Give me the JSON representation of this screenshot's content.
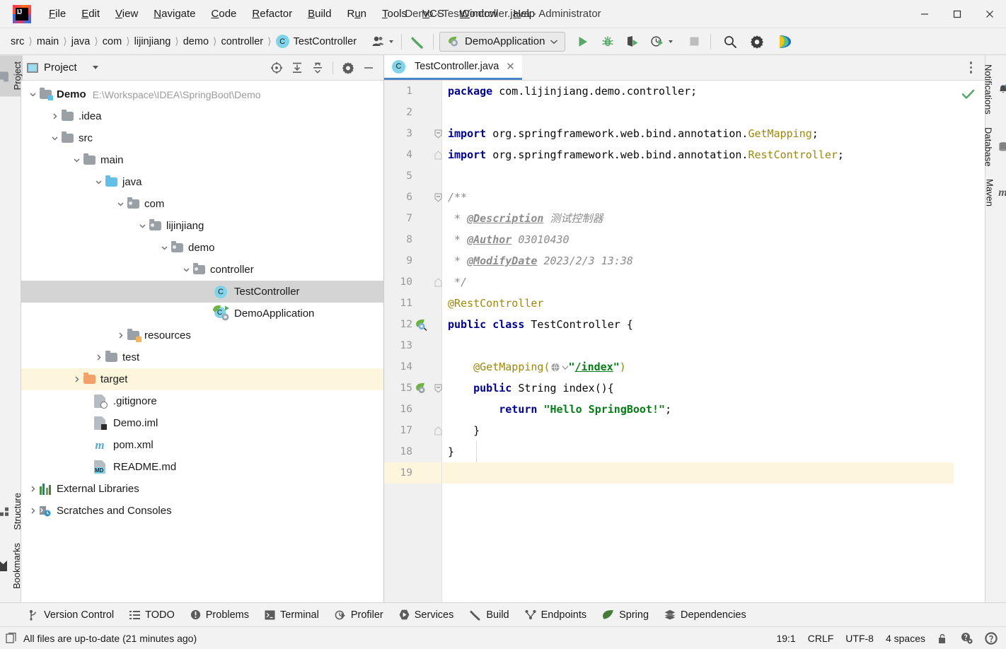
{
  "window": {
    "title": "Demo - TestController.java - Administrator",
    "minimize": "─",
    "maximize": "☐",
    "close": "✕"
  },
  "menu": {
    "items": [
      {
        "label": "File",
        "mnemonic": "F"
      },
      {
        "label": "Edit",
        "mnemonic": "E"
      },
      {
        "label": "View",
        "mnemonic": "V"
      },
      {
        "label": "Navigate",
        "mnemonic": "N"
      },
      {
        "label": "Code",
        "mnemonic": "C"
      },
      {
        "label": "Refactor",
        "mnemonic": "R"
      },
      {
        "label": "Build",
        "mnemonic": "B"
      },
      {
        "label": "Run",
        "mnemonic": "u"
      },
      {
        "label": "Tools",
        "mnemonic": "T"
      },
      {
        "label": "VCS",
        "mnemonic": "V"
      },
      {
        "label": "Window",
        "mnemonic": "W"
      },
      {
        "label": "Help",
        "mnemonic": "H"
      }
    ]
  },
  "navbar": {
    "breadcrumbs": [
      "src",
      "main",
      "java",
      "com",
      "lijinjiang",
      "demo",
      "controller"
    ],
    "current_class": "TestController",
    "class_icon_letter": "C",
    "run_config": "DemoApplication",
    "icons": {
      "profiles": "user-profiles-icon",
      "build": "build-hammer-icon",
      "run": "run-icon",
      "debug": "debug-icon",
      "run_coverage": "run-with-coverage-icon",
      "profile": "profiler-icon",
      "stop": "stop-icon",
      "search": "search-everywhere-icon",
      "settings": "settings-gear-icon",
      "ai": "ai-assistant-icon"
    }
  },
  "left_stripe": {
    "items": [
      {
        "label": "Project",
        "icon": "project-folder-icon",
        "active": true
      },
      {
        "label": "Structure",
        "icon": "structure-icon",
        "active": false
      },
      {
        "label": "Bookmarks",
        "icon": "bookmark-icon",
        "active": false
      }
    ]
  },
  "right_stripe": {
    "items": [
      {
        "label": "Notifications",
        "icon": "notifications-bell-icon"
      },
      {
        "label": "Database",
        "icon": "database-icon"
      },
      {
        "label": "Maven",
        "icon": "maven-m-icon"
      }
    ]
  },
  "project_panel": {
    "title": "Project",
    "tools": [
      {
        "name": "select-opened-file-icon"
      },
      {
        "name": "expand-all-icon"
      },
      {
        "name": "collapse-all-icon"
      },
      {
        "name": "options-gear-icon"
      },
      {
        "name": "hide-icon"
      }
    ],
    "tree": [
      {
        "depth": 0,
        "label": "Demo",
        "suffix": "E:\\Workspace\\IDEA\\SpringBoot\\Demo",
        "icon": "module-folder-icon",
        "arrow": "down",
        "bold": true
      },
      {
        "depth": 1,
        "label": ".idea",
        "icon": "folder-icon",
        "arrow": "right"
      },
      {
        "depth": 1,
        "label": "src",
        "icon": "folder-icon",
        "arrow": "down"
      },
      {
        "depth": 2,
        "label": "main",
        "icon": "folder-icon",
        "arrow": "down"
      },
      {
        "depth": 3,
        "label": "java",
        "icon": "source-folder-icon",
        "arrow": "down"
      },
      {
        "depth": 4,
        "label": "com",
        "icon": "package-icon",
        "arrow": "down"
      },
      {
        "depth": 5,
        "label": "lijinjiang",
        "icon": "package-icon",
        "arrow": "down"
      },
      {
        "depth": 6,
        "label": "demo",
        "icon": "package-icon",
        "arrow": "down"
      },
      {
        "depth": 7,
        "label": "controller",
        "icon": "package-icon",
        "arrow": "down"
      },
      {
        "depth": 8,
        "label": "TestController",
        "icon": "java-class-icon",
        "arrow": "none",
        "selected": true
      },
      {
        "depth": 8,
        "label": "DemoApplication",
        "icon": "spring-boot-class-icon",
        "arrow": "none"
      },
      {
        "depth": 3,
        "label": "resources",
        "icon": "resources-folder-icon",
        "arrow": "right"
      },
      {
        "depth": 2,
        "label": "test",
        "icon": "folder-icon",
        "arrow": "right"
      },
      {
        "depth": 1,
        "label": "target",
        "icon": "excluded-folder-icon",
        "arrow": "right",
        "highlight": true
      },
      {
        "depth": 1,
        "label": ".gitignore",
        "icon": "gitignore-file-icon",
        "arrow": "none"
      },
      {
        "depth": 1,
        "label": "Demo.iml",
        "icon": "iml-file-icon",
        "arrow": "none"
      },
      {
        "depth": 1,
        "label": "pom.xml",
        "icon": "maven-pom-icon",
        "arrow": "none"
      },
      {
        "depth": 1,
        "label": "README.md",
        "icon": "markdown-file-icon",
        "arrow": "none"
      },
      {
        "depth": 0,
        "label": "External Libraries",
        "icon": "external-libraries-icon",
        "arrow": "right"
      },
      {
        "depth": 0,
        "label": "Scratches and Consoles",
        "icon": "scratches-icon",
        "arrow": "right"
      }
    ]
  },
  "editor": {
    "tab": {
      "label": "TestController.java",
      "icon_letter": "C",
      "close": "✕"
    },
    "more_actions": "more-actions-icon",
    "inspection_status": "ok-check-icon",
    "lines": [
      {
        "n": 1,
        "text": "package com.lijinjiang.demo.controller;"
      },
      {
        "n": 2,
        "text": ""
      },
      {
        "n": 3,
        "text": "import org.springframework.web.bind.annotation.GetMapping;"
      },
      {
        "n": 4,
        "text": "import org.springframework.web.bind.annotation.RestController;"
      },
      {
        "n": 5,
        "text": ""
      },
      {
        "n": 6,
        "text": "/**"
      },
      {
        "n": 7,
        "text": " * @Description 测试控制器"
      },
      {
        "n": 8,
        "text": " * @Author 03010430"
      },
      {
        "n": 9,
        "text": " * @ModifyDate 2023/2/3 13:38"
      },
      {
        "n": 10,
        "text": " */"
      },
      {
        "n": 11,
        "text": "@RestController"
      },
      {
        "n": 12,
        "text": "public class TestController {"
      },
      {
        "n": 13,
        "text": ""
      },
      {
        "n": 14,
        "text": "    @GetMapping(\"/index\")"
      },
      {
        "n": 15,
        "text": "    public String index(){"
      },
      {
        "n": 16,
        "text": "        return \"Hello SpringBoot!\";"
      },
      {
        "n": 17,
        "text": "    }"
      },
      {
        "n": 18,
        "text": "}"
      },
      {
        "n": 19,
        "text": ""
      }
    ],
    "gutter_marks": [
      {
        "line": 12,
        "icon": "spring-bean-gutter-icon"
      },
      {
        "line": 15,
        "icon": "spring-endpoint-gutter-icon"
      }
    ],
    "current_line": 19
  },
  "bottom_bar": {
    "items": [
      {
        "label": "Version Control",
        "icon": "vcs-branch-icon"
      },
      {
        "label": "TODO",
        "icon": "todo-list-icon"
      },
      {
        "label": "Problems",
        "icon": "problems-icon"
      },
      {
        "label": "Terminal",
        "icon": "terminal-icon"
      },
      {
        "label": "Profiler",
        "icon": "profiler-icon"
      },
      {
        "label": "Services",
        "icon": "services-icon"
      },
      {
        "label": "Build",
        "icon": "build-hammer-icon"
      },
      {
        "label": "Endpoints",
        "icon": "endpoints-icon"
      },
      {
        "label": "Spring",
        "icon": "spring-leaf-icon"
      },
      {
        "label": "Dependencies",
        "icon": "dependencies-icon"
      }
    ]
  },
  "status_bar": {
    "message": "All files are up-to-date (21 minutes ago)",
    "message_icon": "files-icon",
    "caret_position": "19:1",
    "line_separator": "CRLF",
    "encoding": "UTF-8",
    "indent": "4 spaces",
    "icons": [
      "lock-open-icon",
      "inspection-level-icon",
      "help-icon"
    ]
  },
  "colors": {
    "accent_blue": "#4a86c8",
    "keyword": "#00008f",
    "annotation": "#9e880d",
    "string": "#067d17",
    "comment": "#8c8c8c",
    "selection": "#d4d4d4",
    "highlight_row": "#fdf6dd",
    "green_run": "#59a869"
  }
}
